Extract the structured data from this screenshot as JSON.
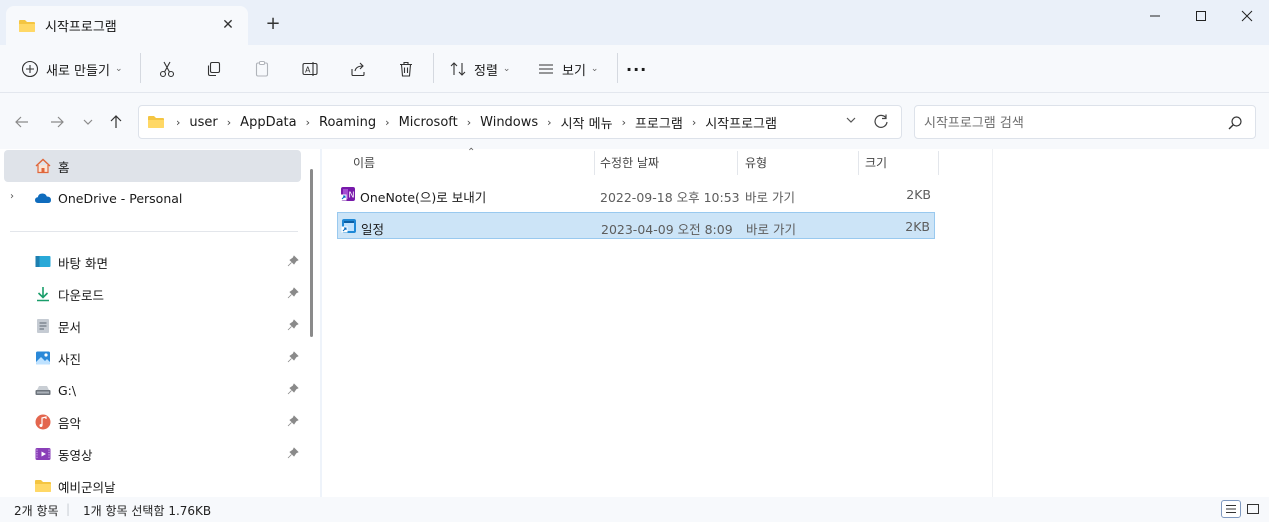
{
  "window": {
    "tab_title": "시작프로그램",
    "new_tab_label": "+",
    "close_tab_label": "✕"
  },
  "toolbar": {
    "new_label": "새로 만들기",
    "sort_label": "정렬",
    "view_label": "보기",
    "more_label": "···"
  },
  "address": {
    "crumbs": [
      "user",
      "AppData",
      "Roaming",
      "Microsoft",
      "Windows",
      "시작 메뉴",
      "프로그램",
      "시작프로그램"
    ],
    "search_placeholder": "시작프로그램 검색"
  },
  "sidebar": {
    "home": "홈",
    "onedrive": "OneDrive - Personal",
    "items": [
      {
        "label": "바탕 화면",
        "icon": "desktop-icon"
      },
      {
        "label": "다운로드",
        "icon": "download-icon"
      },
      {
        "label": "문서",
        "icon": "document-icon"
      },
      {
        "label": "사진",
        "icon": "pictures-icon"
      },
      {
        "label": "G:\\",
        "icon": "drive-icon"
      },
      {
        "label": "음악",
        "icon": "music-icon"
      },
      {
        "label": "동영상",
        "icon": "video-icon"
      },
      {
        "label": "예비군의날",
        "icon": "folder-icon"
      }
    ]
  },
  "columns": {
    "name": "이름",
    "modified": "수정한 날짜",
    "type": "유형",
    "size": "크기"
  },
  "files": [
    {
      "name": "OneNote(으)로 보내기",
      "modified": "2022-09-18 오후 10:53",
      "type": "바로 가기",
      "size": "2KB",
      "selected": false
    },
    {
      "name": "일정",
      "modified": "2023-04-09 오전 8:09",
      "type": "바로 가기",
      "size": "2KB",
      "selected": true
    }
  ],
  "status": {
    "count": "2개 항목",
    "selection": "1개 항목 선택함 1.76KB"
  },
  "colors": {
    "selection": "#cce4f7",
    "accent": "#0067c0",
    "folder": "#f4c542"
  }
}
